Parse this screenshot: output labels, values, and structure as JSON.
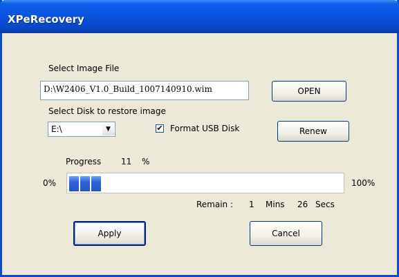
{
  "window": {
    "title": "XPeRecovery"
  },
  "image": {
    "label": "Select Image File",
    "path": "D:\\W2406_V1.0_Build_1007140910.wim",
    "open_label": "OPEN"
  },
  "disk": {
    "label": "Select Disk to restore image",
    "selected": "E:\\",
    "format_label": "Format USB Disk",
    "format_checked": true,
    "renew_label": "Renew"
  },
  "progress": {
    "label": "Progress",
    "value": "11",
    "unit": "%",
    "fraction": 0.11,
    "min_label": "0%",
    "max_label": "100%"
  },
  "remain": {
    "label": "Remain :",
    "mins_value": "1",
    "mins_label": "Mins",
    "secs_value": "26",
    "secs_label": "Secs"
  },
  "buttons": {
    "apply": "Apply",
    "cancel": "Cancel"
  },
  "icons": {
    "dropdown": "chevron-down-icon",
    "check": "checkmark-icon"
  }
}
